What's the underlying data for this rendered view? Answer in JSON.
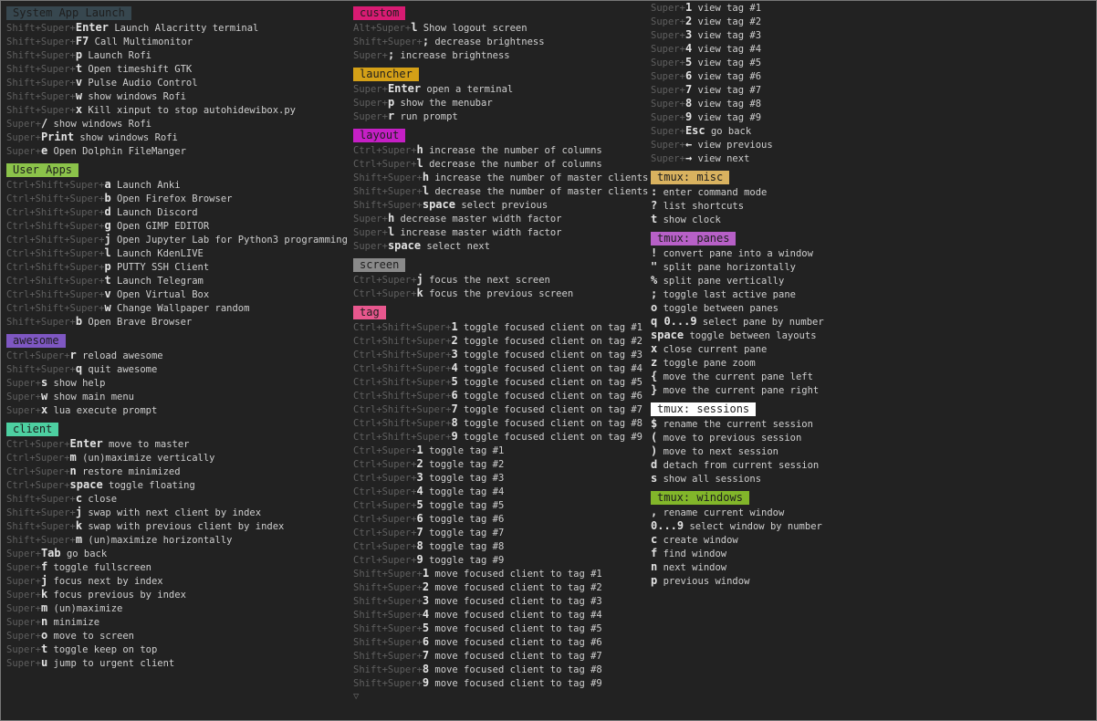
{
  "columns": [
    [
      {
        "title": "System App Launch",
        "bg": "#37474f",
        "fg": "#1e1e1e",
        "items": [
          {
            "mods": "Shift+Super+",
            "key": "Enter",
            "desc": "Launch Alacritty terminal"
          },
          {
            "mods": "Shift+Super+",
            "key": "F7",
            "desc": "Call Multimonitor"
          },
          {
            "mods": "Shift+Super+",
            "key": "p",
            "desc": "Launch Rofi"
          },
          {
            "mods": "Shift+Super+",
            "key": "t",
            "desc": "Open timeshift GTK"
          },
          {
            "mods": "Shift+Super+",
            "key": "v",
            "desc": "Pulse Audio Control"
          },
          {
            "mods": "Shift+Super+",
            "key": "w",
            "desc": "show windows Rofi"
          },
          {
            "mods": "Shift+Super+",
            "key": "x",
            "desc": "Kill xinput to stop autohidewibox.py"
          },
          {
            "mods": "Super+",
            "key": "/",
            "desc": "show windows Rofi"
          },
          {
            "mods": "Super+",
            "key": "Print",
            "desc": "show windows Rofi"
          },
          {
            "mods": "Super+",
            "key": "e",
            "desc": "Open Dolphin FileManger"
          }
        ]
      },
      {
        "title": "User Apps",
        "bg": "#8bc34a",
        "fg": "#1e1e1e",
        "items": [
          {
            "mods": "Ctrl+Shift+Super+",
            "key": "a",
            "desc": "Launch Anki"
          },
          {
            "mods": "Ctrl+Shift+Super+",
            "key": "b",
            "desc": "Open Firefox Browser"
          },
          {
            "mods": "Ctrl+Shift+Super+",
            "key": "d",
            "desc": "Launch Discord"
          },
          {
            "mods": "Ctrl+Shift+Super+",
            "key": "g",
            "desc": "Open GIMP EDITOR"
          },
          {
            "mods": "Ctrl+Shift+Super+",
            "key": "j",
            "desc": "Open Jupyter Lab for Python3 programming"
          },
          {
            "mods": "Ctrl+Shift+Super+",
            "key": "l",
            "desc": "Launch KdenLIVE"
          },
          {
            "mods": "Ctrl+Shift+Super+",
            "key": "p",
            "desc": "PUTTY SSH Client"
          },
          {
            "mods": "Ctrl+Shift+Super+",
            "key": "t",
            "desc": "Launch Telegram"
          },
          {
            "mods": "Ctrl+Shift+Super+",
            "key": "v",
            "desc": "Open Virtual Box"
          },
          {
            "mods": "Ctrl+Shift+Super+",
            "key": "w",
            "desc": "Change Wallpaper random"
          },
          {
            "mods": "Shift+Super+",
            "key": "b",
            "desc": "Open Brave Browser"
          }
        ]
      },
      {
        "title": "awesome",
        "bg": "#7e57c2",
        "fg": "#1e1e1e",
        "items": [
          {
            "mods": "Ctrl+Super+",
            "key": "r",
            "desc": "reload awesome"
          },
          {
            "mods": "Shift+Super+",
            "key": "q",
            "desc": "quit awesome"
          },
          {
            "mods": "Super+",
            "key": "s",
            "desc": "show help"
          },
          {
            "mods": "Super+",
            "key": "w",
            "desc": "show main menu"
          },
          {
            "mods": "Super+",
            "key": "x",
            "desc": "lua execute prompt"
          }
        ]
      },
      {
        "title": "client",
        "bg": "#4dd0a1",
        "fg": "#1e1e1e",
        "items": [
          {
            "mods": "Ctrl+Super+",
            "key": "Enter",
            "desc": "move to master"
          },
          {
            "mods": "Ctrl+Super+",
            "key": "m",
            "desc": "(un)maximize vertically"
          },
          {
            "mods": "Ctrl+Super+",
            "key": "n",
            "desc": "restore minimized"
          },
          {
            "mods": "Ctrl+Super+",
            "key": "space",
            "desc": "toggle floating"
          },
          {
            "mods": "Shift+Super+",
            "key": "c",
            "desc": "close"
          },
          {
            "mods": "Shift+Super+",
            "key": "j",
            "desc": "swap with next client by index"
          },
          {
            "mods": "Shift+Super+",
            "key": "k",
            "desc": "swap with previous client by index"
          },
          {
            "mods": "Shift+Super+",
            "key": "m",
            "desc": "(un)maximize horizontally"
          },
          {
            "mods": "Super+",
            "key": "Tab",
            "desc": "go back"
          },
          {
            "mods": "Super+",
            "key": "f",
            "desc": "toggle fullscreen"
          },
          {
            "mods": "Super+",
            "key": "j",
            "desc": "focus next by index"
          },
          {
            "mods": "Super+",
            "key": "k",
            "desc": "focus previous by index"
          },
          {
            "mods": "Super+",
            "key": "m",
            "desc": "(un)maximize"
          },
          {
            "mods": "Super+",
            "key": "n",
            "desc": "minimize"
          },
          {
            "mods": "Super+",
            "key": "o",
            "desc": "move to screen"
          },
          {
            "mods": "Super+",
            "key": "t",
            "desc": "toggle keep on top"
          },
          {
            "mods": "Super+",
            "key": "u",
            "desc": "jump to urgent client"
          }
        ]
      }
    ],
    [
      {
        "title": "custom",
        "bg": "#d81b73",
        "fg": "#1e1e1e",
        "items": [
          {
            "mods": "Alt+Super+",
            "key": "l",
            "desc": "Show logout screen"
          },
          {
            "mods": "Shift+Super+",
            "key": ";",
            "desc": "decrease brightness"
          },
          {
            "mods": "Super+",
            "key": ";",
            "desc": "increase brightness"
          }
        ]
      },
      {
        "title": "launcher",
        "bg": "#d4a017",
        "fg": "#1e1e1e",
        "items": [
          {
            "mods": "Super+",
            "key": "Enter",
            "desc": "open a terminal"
          },
          {
            "mods": "Super+",
            "key": "p",
            "desc": "show the menubar"
          },
          {
            "mods": "Super+",
            "key": "r",
            "desc": "run prompt"
          }
        ]
      },
      {
        "title": "layout",
        "bg": "#c51fc5",
        "fg": "#1e1e1e",
        "items": [
          {
            "mods": "Ctrl+Super+",
            "key": "h",
            "desc": "increase the number of columns"
          },
          {
            "mods": "Ctrl+Super+",
            "key": "l",
            "desc": "decrease the number of columns"
          },
          {
            "mods": "Shift+Super+",
            "key": "h",
            "desc": "increase the number of master clients"
          },
          {
            "mods": "Shift+Super+",
            "key": "l",
            "desc": "decrease the number of master clients"
          },
          {
            "mods": "Shift+Super+",
            "key": "space",
            "desc": "select previous"
          },
          {
            "mods": "Super+",
            "key": "h",
            "desc": "decrease master width factor"
          },
          {
            "mods": "Super+",
            "key": "l",
            "desc": "increase master width factor"
          },
          {
            "mods": "Super+",
            "key": "space",
            "desc": "select next"
          }
        ]
      },
      {
        "title": "screen",
        "bg": "#8a8a8a",
        "fg": "#1e1e1e",
        "items": [
          {
            "mods": "Ctrl+Super+",
            "key": "j",
            "desc": "focus the next screen"
          },
          {
            "mods": "Ctrl+Super+",
            "key": "k",
            "desc": "focus the previous screen"
          }
        ]
      },
      {
        "title": "tag",
        "bg": "#e8578e",
        "fg": "#1e1e1e",
        "items": [
          {
            "mods": "Ctrl+Shift+Super+",
            "key": "1",
            "desc": "toggle focused client on tag #1"
          },
          {
            "mods": "Ctrl+Shift+Super+",
            "key": "2",
            "desc": "toggle focused client on tag #2"
          },
          {
            "mods": "Ctrl+Shift+Super+",
            "key": "3",
            "desc": "toggle focused client on tag #3"
          },
          {
            "mods": "Ctrl+Shift+Super+",
            "key": "4",
            "desc": "toggle focused client on tag #4"
          },
          {
            "mods": "Ctrl+Shift+Super+",
            "key": "5",
            "desc": "toggle focused client on tag #5"
          },
          {
            "mods": "Ctrl+Shift+Super+",
            "key": "6",
            "desc": "toggle focused client on tag #6"
          },
          {
            "mods": "Ctrl+Shift+Super+",
            "key": "7",
            "desc": "toggle focused client on tag #7"
          },
          {
            "mods": "Ctrl+Shift+Super+",
            "key": "8",
            "desc": "toggle focused client on tag #8"
          },
          {
            "mods": "Ctrl+Shift+Super+",
            "key": "9",
            "desc": "toggle focused client on tag #9"
          },
          {
            "mods": "Ctrl+Super+",
            "key": "1",
            "desc": "toggle tag #1"
          },
          {
            "mods": "Ctrl+Super+",
            "key": "2",
            "desc": "toggle tag #2"
          },
          {
            "mods": "Ctrl+Super+",
            "key": "3",
            "desc": "toggle tag #3"
          },
          {
            "mods": "Ctrl+Super+",
            "key": "4",
            "desc": "toggle tag #4"
          },
          {
            "mods": "Ctrl+Super+",
            "key": "5",
            "desc": "toggle tag #5"
          },
          {
            "mods": "Ctrl+Super+",
            "key": "6",
            "desc": "toggle tag #6"
          },
          {
            "mods": "Ctrl+Super+",
            "key": "7",
            "desc": "toggle tag #7"
          },
          {
            "mods": "Ctrl+Super+",
            "key": "8",
            "desc": "toggle tag #8"
          },
          {
            "mods": "Ctrl+Super+",
            "key": "9",
            "desc": "toggle tag #9"
          },
          {
            "mods": "Shift+Super+",
            "key": "1",
            "desc": "move focused client to tag #1"
          },
          {
            "mods": "Shift+Super+",
            "key": "2",
            "desc": "move focused client to tag #2"
          },
          {
            "mods": "Shift+Super+",
            "key": "3",
            "desc": "move focused client to tag #3"
          },
          {
            "mods": "Shift+Super+",
            "key": "4",
            "desc": "move focused client to tag #4"
          },
          {
            "mods": "Shift+Super+",
            "key": "5",
            "desc": "move focused client to tag #5"
          },
          {
            "mods": "Shift+Super+",
            "key": "6",
            "desc": "move focused client to tag #6"
          },
          {
            "mods": "Shift+Super+",
            "key": "7",
            "desc": "move focused client to tag #7"
          },
          {
            "mods": "Shift+Super+",
            "key": "8",
            "desc": "move focused client to tag #8"
          },
          {
            "mods": "Shift+Super+",
            "key": "9",
            "desc": "move focused client to tag #9"
          }
        ],
        "more_indicator": "▽"
      }
    ],
    [
      {
        "title": "",
        "bg": "",
        "fg": "",
        "items": [
          {
            "mods": "Super+",
            "key": "1",
            "desc": "view tag #1"
          },
          {
            "mods": "Super+",
            "key": "2",
            "desc": "view tag #2"
          },
          {
            "mods": "Super+",
            "key": "3",
            "desc": "view tag #3"
          },
          {
            "mods": "Super+",
            "key": "4",
            "desc": "view tag #4"
          },
          {
            "mods": "Super+",
            "key": "5",
            "desc": "view tag #5"
          },
          {
            "mods": "Super+",
            "key": "6",
            "desc": "view tag #6"
          },
          {
            "mods": "Super+",
            "key": "7",
            "desc": "view tag #7"
          },
          {
            "mods": "Super+",
            "key": "8",
            "desc": "view tag #8"
          },
          {
            "mods": "Super+",
            "key": "9",
            "desc": "view tag #9"
          },
          {
            "mods": "Super+",
            "key": "Esc",
            "desc": "go back"
          },
          {
            "mods": "Super+",
            "key": "←",
            "desc": "view previous"
          },
          {
            "mods": "Super+",
            "key": "→",
            "desc": "view next"
          }
        ]
      },
      {
        "title": "tmux: misc",
        "bg": "#d9b25f",
        "fg": "#1e1e1e",
        "items": [
          {
            "mods": "",
            "key": ":",
            "desc": "enter command mode"
          },
          {
            "mods": "",
            "key": "?",
            "desc": "list shortcuts"
          },
          {
            "mods": "",
            "key": "t",
            "desc": "show clock"
          }
        ]
      },
      {
        "title": "tmux: panes",
        "bg": "#b760c7",
        "fg": "#1e1e1e",
        "items": [
          {
            "mods": "",
            "key": "!",
            "desc": "convert pane into a window"
          },
          {
            "mods": "",
            "key": "\"",
            "desc": "split pane horizontally"
          },
          {
            "mods": "",
            "key": "%",
            "desc": "split pane vertically"
          },
          {
            "mods": "",
            "key": ";",
            "desc": "toggle last active pane"
          },
          {
            "mods": "",
            "key": "o",
            "desc": "toggle between panes"
          },
          {
            "mods": "",
            "key": "q 0...9",
            "desc": "select pane by number"
          },
          {
            "mods": "",
            "key": "space",
            "desc": "toggle between layouts"
          },
          {
            "mods": "",
            "key": "x",
            "desc": "close current pane"
          },
          {
            "mods": "",
            "key": "z",
            "desc": "toggle pane zoom"
          },
          {
            "mods": "",
            "key": "{",
            "desc": "move the current pane left"
          },
          {
            "mods": "",
            "key": "}",
            "desc": "move the current pane right"
          }
        ]
      },
      {
        "title": "tmux: sessions",
        "bg": "#ffffff",
        "fg": "#1e1e1e",
        "items": [
          {
            "mods": "",
            "key": "$",
            "desc": "rename the current session"
          },
          {
            "mods": "",
            "key": "(",
            "desc": "move to previous session"
          },
          {
            "mods": "",
            "key": ")",
            "desc": "move to next session"
          },
          {
            "mods": "",
            "key": "d",
            "desc": "detach from current session"
          },
          {
            "mods": "",
            "key": "s",
            "desc": "show all sessions"
          }
        ]
      },
      {
        "title": "tmux: windows",
        "bg": "#82b62a",
        "fg": "#1e1e1e",
        "items": [
          {
            "mods": "",
            "key": ",",
            "desc": "rename current window"
          },
          {
            "mods": "",
            "key": "0...9",
            "desc": "select window by number"
          },
          {
            "mods": "",
            "key": "c",
            "desc": "create window"
          },
          {
            "mods": "",
            "key": "f",
            "desc": "find window"
          },
          {
            "mods": "",
            "key": "n",
            "desc": "next window"
          },
          {
            "mods": "",
            "key": "p",
            "desc": "previous window"
          }
        ]
      }
    ]
  ]
}
